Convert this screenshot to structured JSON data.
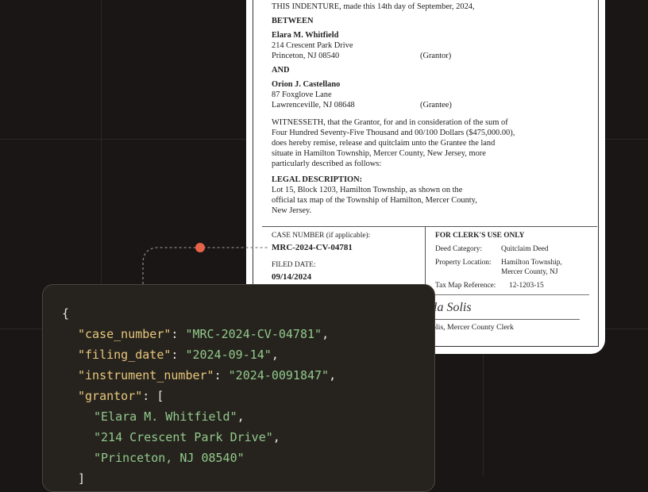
{
  "deed": {
    "intro": "THIS INDENTURE, made this 14th day of September, 2024,",
    "between": "BETWEEN",
    "grantor_name": "Elara M. Whitfield",
    "grantor_street": "214 Crescent Park Drive",
    "grantor_city": "Princeton, NJ 08540",
    "grantor_role": "(Grantor)",
    "and": "AND",
    "grantee_name": "Orion J. Castellano",
    "grantee_street": "87 Foxglove Lane",
    "grantee_city": "Lawrenceville, NJ 08648",
    "grantee_role": "(Grantee)",
    "witness_lines": [
      "WITNESSETH, that the Grantor, for and in consideration of the sum of",
      "Four Hundred Seventy-Five Thousand and 00/100 Dollars ($475,000.00),",
      "does hereby remise, release and quitclaim unto the Grantee the land",
      "situate in Hamilton Township, Mercer County, New Jersey, more",
      "particularly described as follows:"
    ],
    "legal_heading": "LEGAL DESCRIPTION:",
    "legal_lines": [
      "Lot 15, Block 1203, Hamilton Township, as shown on the",
      "official tax map of the Township of Hamilton, Mercer County,",
      "New Jersey."
    ],
    "case_label": "CASE NUMBER (if applicable):",
    "case_value": "MRC-2024-CV-04781",
    "filed_label": "FILED DATE:",
    "filed_value": "09/14/2024",
    "clerk_heading": "FOR CLERK'S USE ONLY",
    "deed_category_label": "Deed Category:",
    "deed_category_value": "Quitclaim Deed",
    "property_location_label": "Property Location:",
    "property_location_value_1": "Hamilton Township,",
    "property_location_value_2": "Mercer County, NJ",
    "tax_map_label": "Tax Map Reference:",
    "tax_map_value": "12-1203-15",
    "signature": "la Solis",
    "clerk_caption": "olis, Mercer County Clerk"
  },
  "json_panel": {
    "open_brace": "{",
    "case_number_key": "\"case_number\"",
    "case_number_value": "\"MRC-2024-CV-04781\"",
    "filing_date_key": "\"filing_date\"",
    "filing_date_value": "\"2024-09-14\"",
    "instrument_number_key": "\"instrument_number\"",
    "instrument_number_value": "\"2024-0091847\"",
    "grantor_key": "\"grantor\"",
    "grantor_values": [
      "\"Elara M. Whitfield\"",
      "\"214 Crescent Park Drive\"",
      "\"Princeton, NJ 08540\""
    ],
    "close_bracket": "]"
  },
  "colors": {
    "background": "#1a1616",
    "connector_dot": "#e8624a",
    "json_key": "#e8c77a",
    "json_string": "#92c98a"
  }
}
